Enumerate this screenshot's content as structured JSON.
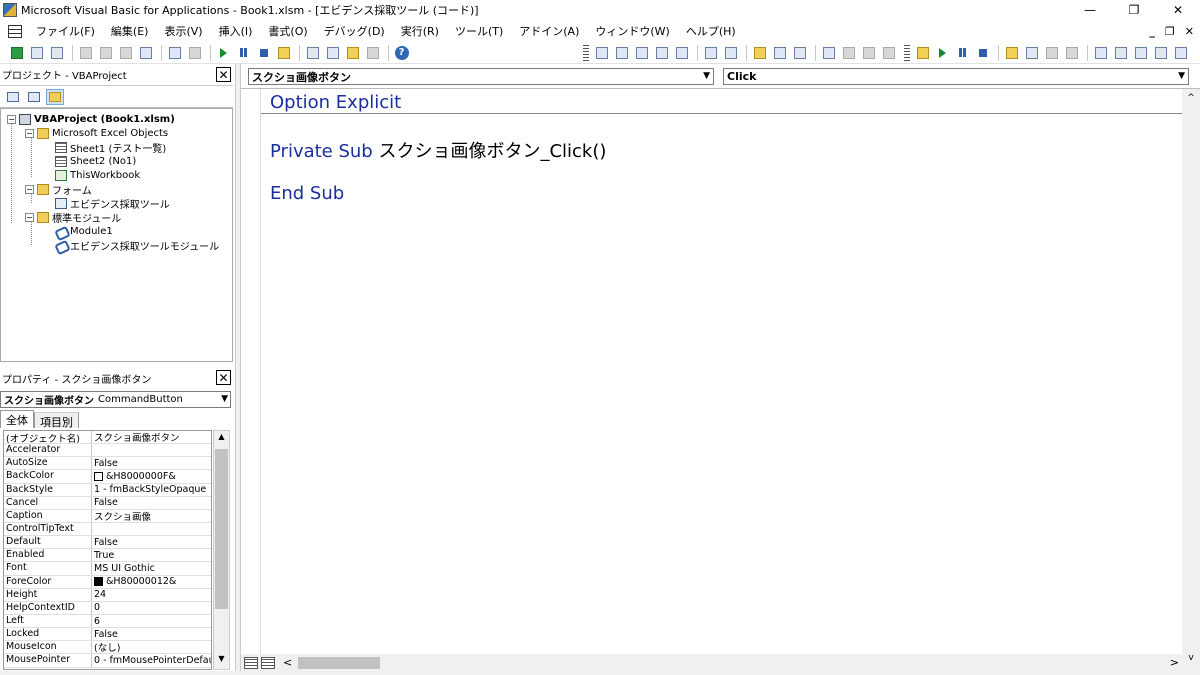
{
  "window": {
    "title": "Microsoft Visual Basic for Applications - Book1.xlsm - [エビデンス採取ツール (コード)]",
    "controls": [
      "—",
      "❐",
      "✕"
    ]
  },
  "menu": {
    "items": [
      "ファイル(F)",
      "編集(E)",
      "表示(V)",
      "挿入(I)",
      "書式(O)",
      "デバッグ(D)",
      "実行(R)",
      "ツール(T)",
      "アドイン(A)",
      "ウィンドウ(W)",
      "ヘルプ(H)"
    ],
    "mdi_controls": [
      "_",
      "❐",
      "✕"
    ]
  },
  "project": {
    "header": "プロジェクト - VBAProject",
    "close": "✕",
    "tree": {
      "root": "VBAProject (Book1.xlsm)",
      "excel_objects": "Microsoft Excel Objects",
      "sheet1": "Sheet1 (テスト一覧)",
      "sheet2": "Sheet2 (No1)",
      "workbook": "ThisWorkbook",
      "forms": "フォーム",
      "form1": "エビデンス採取ツール",
      "modules": "標準モジュール",
      "module1": "Module1",
      "module2": "エビデンス採取ツールモジュール"
    }
  },
  "properties": {
    "header": "プロパティ - スクショ画像ボタン",
    "close": "✕",
    "combo_name": "スクショ画像ボタン",
    "combo_type": "CommandButton",
    "tabs": [
      "全体",
      "項目別"
    ],
    "rows": [
      {
        "name": "(オブジェクト名)",
        "value": "スクショ画像ボタン"
      },
      {
        "name": "Accelerator",
        "value": ""
      },
      {
        "name": "AutoSize",
        "value": "False"
      },
      {
        "name": "BackColor",
        "value": "&H8000000F&"
      },
      {
        "name": "BackStyle",
        "value": "1 - fmBackStyleOpaque"
      },
      {
        "name": "Cancel",
        "value": "False"
      },
      {
        "name": "Caption",
        "value": "スクショ画像"
      },
      {
        "name": "ControlTipText",
        "value": ""
      },
      {
        "name": "Default",
        "value": "False"
      },
      {
        "name": "Enabled",
        "value": "True"
      },
      {
        "name": "Font",
        "value": "MS UI Gothic"
      },
      {
        "name": "ForeColor",
        "value": "&H80000012&"
      },
      {
        "name": "Height",
        "value": "24"
      },
      {
        "name": "HelpContextID",
        "value": "0"
      },
      {
        "name": "Left",
        "value": "6"
      },
      {
        "name": "Locked",
        "value": "False"
      },
      {
        "name": "MouseIcon",
        "value": "(なし)"
      },
      {
        "name": "MousePointer",
        "value": "0 - fmMousePointerDefau"
      }
    ],
    "backcolor_swatch": "#ffffff",
    "forecolor_swatch": "#000000"
  },
  "code": {
    "object_combo": "スクショ画像ボタン",
    "procedure_combo": "Click",
    "line1": "Option Explicit",
    "line2_kw": "Private Sub ",
    "line2_name": "スクショ画像ボタン_Click()",
    "line3": "End Sub",
    "keyword_color": "#1a2f9e"
  }
}
